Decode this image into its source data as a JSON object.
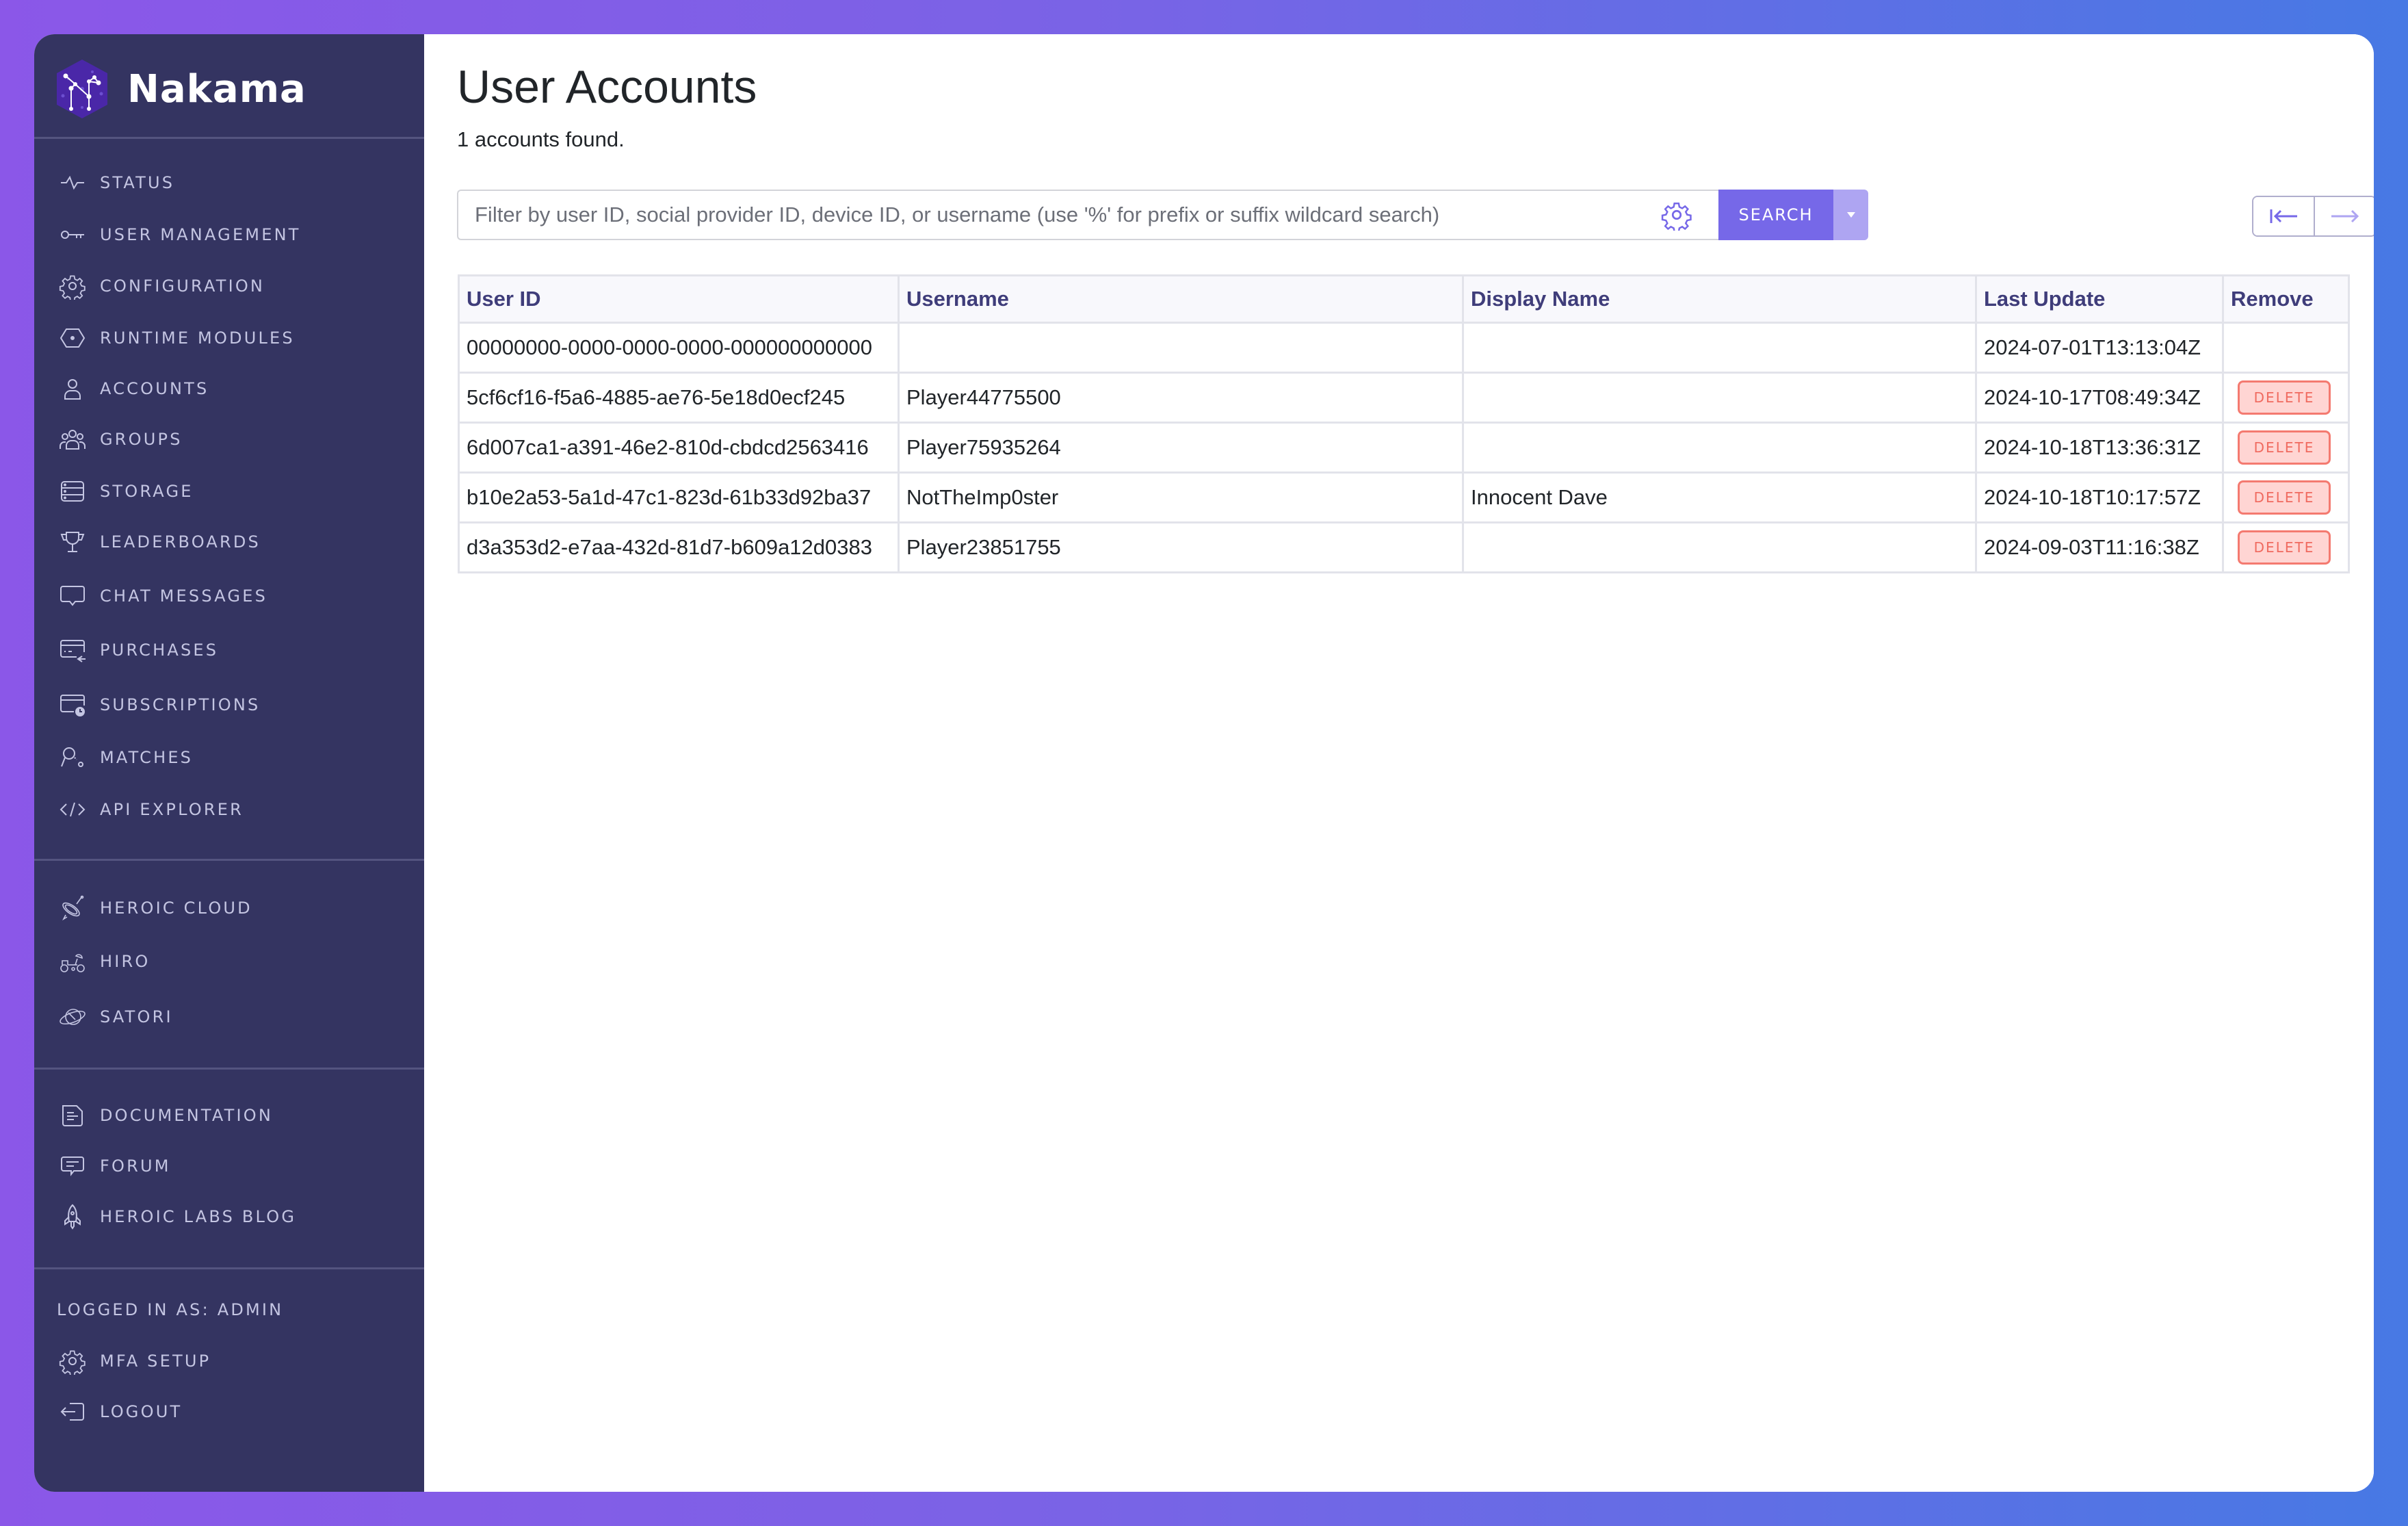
{
  "app": {
    "brand": "Nakama",
    "colors": {
      "sidebar_bg": "#343461",
      "accent": "#7668e8",
      "accent_light": "#aea5f2",
      "danger": "#f06a5f",
      "danger_bg": "#ffd5d3",
      "header_text": "#3f3d7a"
    }
  },
  "sidebar": {
    "primary": [
      {
        "label": "Status",
        "icon": "activity-icon"
      },
      {
        "label": "User Management",
        "icon": "key-icon"
      },
      {
        "label": "Configuration",
        "icon": "gear-icon"
      },
      {
        "label": "Runtime Modules",
        "icon": "hexagon-icon"
      },
      {
        "label": "Accounts",
        "icon": "user-icon"
      },
      {
        "label": "Groups",
        "icon": "users-icon"
      },
      {
        "label": "Storage",
        "icon": "database-icon"
      },
      {
        "label": "Leaderboards",
        "icon": "trophy-icon"
      },
      {
        "label": "Chat Messages",
        "icon": "chat-icon"
      },
      {
        "label": "Purchases",
        "icon": "credit-card-icon"
      },
      {
        "label": "Subscriptions",
        "icon": "card-clock-icon"
      },
      {
        "label": "Matches",
        "icon": "search-matches-icon"
      },
      {
        "label": "API Explorer",
        "icon": "code-icon"
      }
    ],
    "products": [
      {
        "label": "Heroic Cloud",
        "icon": "satellite-icon"
      },
      {
        "label": "Hiro",
        "icon": "rover-icon"
      },
      {
        "label": "Satori",
        "icon": "planet-icon"
      }
    ],
    "resources": [
      {
        "label": "Documentation",
        "icon": "document-icon"
      },
      {
        "label": "Forum",
        "icon": "forum-icon"
      },
      {
        "label": "Heroic Labs Blog",
        "icon": "rocket-icon"
      }
    ],
    "logged_in_as": "LOGGED IN AS: ADMIN",
    "account": [
      {
        "label": "MFA Setup",
        "icon": "gear-icon"
      },
      {
        "label": "Logout",
        "icon": "logout-icon"
      }
    ]
  },
  "main": {
    "title": "User Accounts",
    "count_text": "1 accounts found.",
    "search": {
      "placeholder": "Filter by user ID, social provider ID, device ID, or username (use '%' for prefix or suffix wildcard search)",
      "value": "",
      "button_label": "SEARCH"
    },
    "pagination": {
      "first_label": "first-page",
      "next_label": "next-page"
    },
    "table": {
      "columns": [
        "User ID",
        "Username",
        "Display Name",
        "Last Update",
        "Remove"
      ],
      "delete_label": "DELETE",
      "rows": [
        {
          "user_id": "00000000-0000-0000-0000-000000000000",
          "username": "",
          "display_name": "",
          "last_update": "2024-07-01T13:13:04Z",
          "deletable": false
        },
        {
          "user_id": "5cf6cf16-f5a6-4885-ae76-5e18d0ecf245",
          "username": "Player44775500",
          "display_name": "",
          "last_update": "2024-10-17T08:49:34Z",
          "deletable": true
        },
        {
          "user_id": "6d007ca1-a391-46e2-810d-cbdcd2563416",
          "username": "Player75935264",
          "display_name": "",
          "last_update": "2024-10-18T13:36:31Z",
          "deletable": true
        },
        {
          "user_id": "b10e2a53-5a1d-47c1-823d-61b33d92ba37",
          "username": "NotTheImp0ster",
          "display_name": "Innocent Dave",
          "last_update": "2024-10-18T10:17:57Z",
          "deletable": true
        },
        {
          "user_id": "d3a353d2-e7aa-432d-81d7-b609a12d0383",
          "username": "Player23851755",
          "display_name": "",
          "last_update": "2024-09-03T11:16:38Z",
          "deletable": true
        }
      ]
    }
  }
}
